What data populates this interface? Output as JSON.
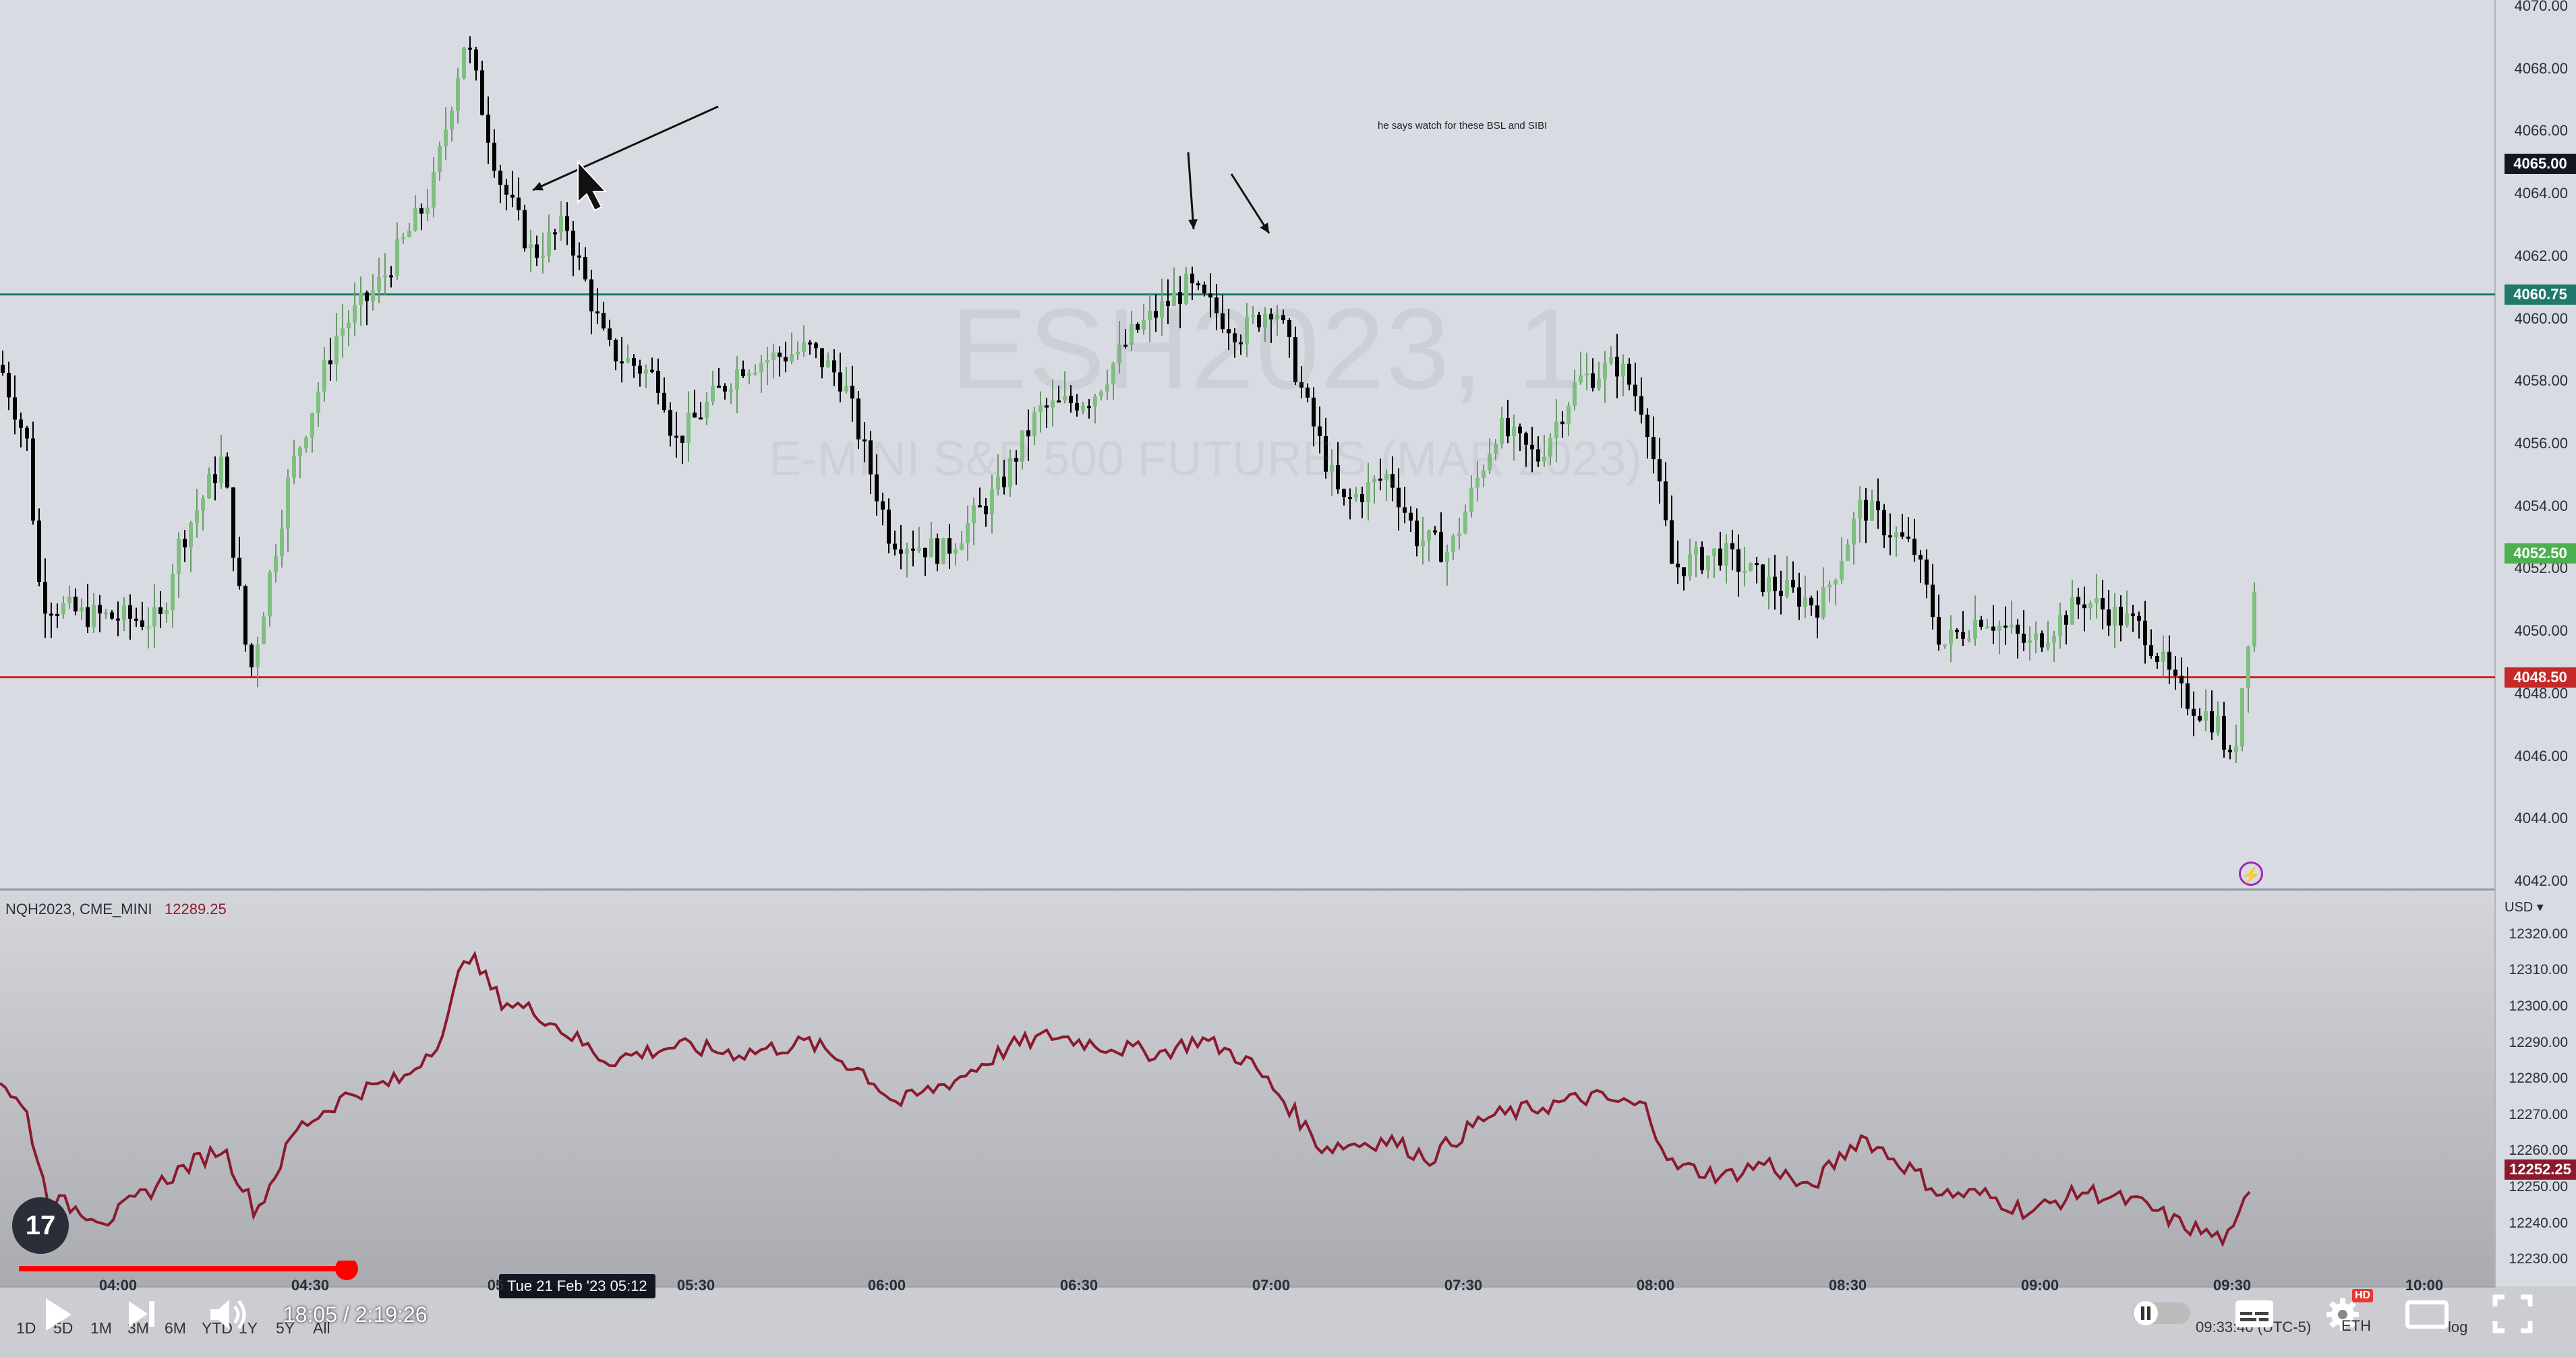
{
  "chart": {
    "watermark_symbol": "ESH2023, 1",
    "watermark_name": "E-MINI S&P 500 FUTURES (MAR 2023)",
    "annotation": "he says watch for these BSL and SIBI",
    "price_axis_labels": [
      "4070.00",
      "4068.00",
      "4066.00",
      "4064.00",
      "4062.00",
      "4060.00",
      "4058.00",
      "4056.00",
      "4054.00",
      "4052.00",
      "4050.00",
      "4048.00",
      "4046.00",
      "4044.00",
      "4042.00"
    ],
    "price_tags": {
      "crosshair": "4065.00",
      "green_line": "4060.75",
      "last": "4052.50",
      "red_line": "4048.50"
    },
    "colors": {
      "up_candle": "#7fbf7f",
      "down_candle": "#000000",
      "green_line": "#1f7a6b",
      "red_line": "#c62828",
      "sub_line": "#8b1a2e"
    },
    "lower_pane": {
      "ticker": "NQH2023, CME_MINI",
      "value": "12289.25",
      "currency": "USD",
      "axis_labels": [
        "12320.00",
        "12310.00",
        "12300.00",
        "12290.00",
        "12280.00",
        "12270.00",
        "12260.00",
        "12250.00",
        "12240.00",
        "12230.00"
      ],
      "last_tag": "12252.25"
    },
    "time_labels": [
      "04:00",
      "04:30",
      "05",
      "05:30",
      "06:00",
      "06:30",
      "07:00",
      "07:30",
      "08:00",
      "08:30",
      "09:00",
      "09:30",
      "10:00"
    ],
    "hover_time": "Tue 21 Feb '23   05:12"
  },
  "chart_data": {
    "type": "candlestick",
    "x_label": "time",
    "y_label": "price",
    "ylim": [
      4042,
      4070
    ],
    "series": [
      {
        "name": "ESH2023",
        "x": [
          "04:00",
          "04:30",
          "05:00",
          "05:30",
          "06:00",
          "06:30",
          "07:00",
          "07:30",
          "08:00",
          "08:30",
          "09:00",
          "09:30"
        ],
        "values": [
          4050.5,
          4049.0,
          4068.5,
          4058.5,
          4053.0,
          4058.0,
          4060.5,
          4055.0,
          4057.5,
          4052.0,
          4050.0,
          4052.5
        ]
      }
    ],
    "horizontal_lines": [
      4060.75,
      4048.5
    ]
  },
  "toolbar": {
    "ranges": [
      "1D",
      "5D",
      "1M",
      "3M",
      "6M",
      "YTD",
      "1Y",
      "5Y",
      "All"
    ],
    "video_time": "18:05 / 2:19:26",
    "clock": "09:33:40 (UTC-5)",
    "session": "ETH",
    "log": "log",
    "hd": "HD"
  },
  "icons": {
    "play": "play-icon",
    "next": "next-icon",
    "volume": "volume-icon",
    "pause": "pause-icon",
    "captions": "captions-icon",
    "settings": "gear-icon",
    "theater": "theater-icon",
    "fullscreen": "fullscreen-icon"
  }
}
